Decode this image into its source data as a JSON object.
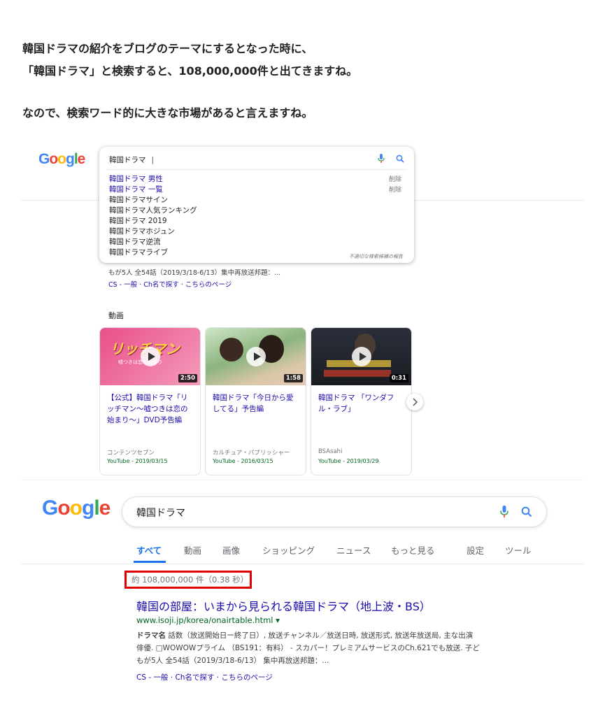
{
  "intro": {
    "line1": "韓国ドラマの紹介をブログのテーマにするとなった時に、",
    "line2": "「韓国ドラマ」と検索すると、108,000,000件と出てきますね。",
    "line3": "なので、検索ワード的に大きな市場があると言えますね。"
  },
  "logo": [
    "G",
    "o",
    "o",
    "g",
    "l",
    "e"
  ],
  "top": {
    "query": "韓国ドラマ",
    "suggestions": [
      "韓国ドラマ 男性",
      "韓国ドラマ 一覧",
      "韓国ドラマサイン",
      "韓国ドラマ人気ランキング",
      "韓国ドラマ 2019",
      "韓国ドラマホジュン",
      "韓国ドラマ逆流",
      "韓国ドラマライブ"
    ],
    "delete_label": "削除",
    "report_label": "不適切な検索候補の報告",
    "snippet_line": "もが5人 全54話（2019/3/18-6/13）集中再放送邦題：...",
    "links": "CS - 一般 · Ch名で探す · こちらのページ",
    "videos_heading": "動画",
    "videos": [
      {
        "title": "【公式】韓国ドラマ「リッチマン〜嘘つきは恋の始まり〜」DVD予告編",
        "duration": "2:50",
        "publisher": "コンテンツセブン",
        "source": "YouTube - 2019/03/15",
        "thumb_text": "リッチマン",
        "thumb_sub": "嘘つきは恋の始まり"
      },
      {
        "title": "韓国ドラマ「今日から愛してる」予告編",
        "duration": "1:58",
        "publisher": "カルチュア・パブリッシャー",
        "source": "YouTube - 2016/03/15"
      },
      {
        "title": "韓国ドラマ 「ワンダフル・ラブ」",
        "duration": "0:31",
        "publisher": "BSAsahi",
        "source": "YouTube - 2019/03/29"
      }
    ]
  },
  "bottom": {
    "query": "韓国ドラマ",
    "tabs": [
      "すべて",
      "動画",
      "画像",
      "ショッピング",
      "ニュース",
      "もっと見る",
      "設定",
      "ツール"
    ],
    "result_count": "約 108,000,000 件（0.38 秒）",
    "result_title": "韓国の部屋：いまから見られる韓国ドラマ（地上波・BS）",
    "result_url": "www.isoji.jp/korea/onairtable.html ▾",
    "snippet1_bold": "ドラマ名",
    "snippet1": " 話数（放送開始日ー終了日）, 放送チャンネル／放送日時, 放送形式, 放送年放送局, 主な出演",
    "snippet2": "俳優. □WOWOWプライム （BS191：有料） - スカパー！プレミアムサービスのCh.621でも放送. 子ど",
    "snippet3": "もが5人 全54話（2019/3/18-6/13） 集中再放送邦題：...",
    "links": "CS - 一般 · Ch名で探す · こちらのページ"
  },
  "colors": {
    "highlight_box": "#e00000",
    "link": "#1a0dab",
    "url": "#006621",
    "active_tab": "#1a73e8"
  }
}
